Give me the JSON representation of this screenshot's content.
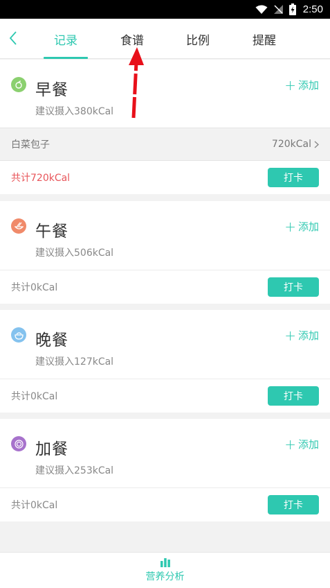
{
  "status_bar": {
    "time": "2:50"
  },
  "nav": {
    "tabs": [
      {
        "label": "记录",
        "active": true
      },
      {
        "label": "食谱",
        "active": false
      },
      {
        "label": "比例",
        "active": false
      },
      {
        "label": "提醒",
        "active": false
      }
    ]
  },
  "meals": [
    {
      "title": "早餐",
      "suggest": "建议摄入380kCal",
      "add_label": "添加",
      "icon": "apple-icon",
      "icon_color": "#8bd06f",
      "foods": [
        {
          "name": "白菜包子",
          "kcal": "720kCal"
        }
      ],
      "total": "共计720kCal",
      "punch_label": "打卡"
    },
    {
      "title": "午餐",
      "suggest": "建议摄入506kCal",
      "add_label": "添加",
      "icon": "bowl-chopsticks-icon",
      "icon_color": "#f08a6a",
      "foods": [],
      "total": "共计0kCal",
      "punch_label": "打卡"
    },
    {
      "title": "晚餐",
      "suggest": "建议摄入127kCal",
      "add_label": "添加",
      "icon": "rice-bowl-icon",
      "icon_color": "#84c2ee",
      "foods": [],
      "total": "共计0kCal",
      "punch_label": "打卡"
    },
    {
      "title": "加餐",
      "suggest": "建议摄入253kCal",
      "add_label": "添加",
      "icon": "plate-icon",
      "icon_color": "#a772cc",
      "foods": [],
      "total": "共计0kCal",
      "punch_label": "打卡"
    }
  ],
  "bottom_bar": {
    "label": "营养分析",
    "icon": "bar-chart-icon"
  },
  "colors": {
    "accent": "#2ec8b0",
    "total_highlight": "#e8555a"
  }
}
